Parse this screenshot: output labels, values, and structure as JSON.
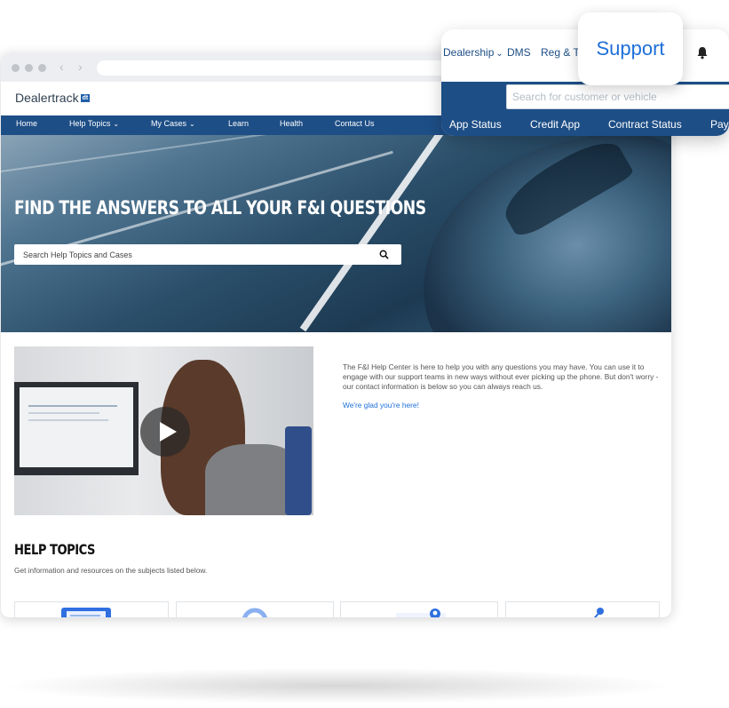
{
  "site": {
    "logo_text": "Dealertrack",
    "logo_badge": "dt"
  },
  "nav": {
    "items": [
      {
        "label": "Home",
        "dropdown": false
      },
      {
        "label": "Help Topics",
        "dropdown": true
      },
      {
        "label": "My Cases",
        "dropdown": true
      },
      {
        "label": "Learn",
        "dropdown": false
      },
      {
        "label": "Health",
        "dropdown": false
      },
      {
        "label": "Contact Us",
        "dropdown": false
      }
    ]
  },
  "hero": {
    "title": "FIND THE ANSWERS TO ALL YOUR F&I QUESTIONS",
    "search_placeholder": "Search Help Topics and Cases"
  },
  "intro": {
    "text": "The F&I Help Center is here to help you with any questions you may have. You can use it to engage with our support teams in new ways without ever picking up the phone. But don't worry - our contact information is below so you can always reach us.",
    "link": "We're glad you're here!"
  },
  "help_topics": {
    "title": "HELP TOPICS",
    "subtitle": "Get information and resources on the subjects listed below."
  },
  "support_panel": {
    "top_items": [
      "Dealership",
      "DMS",
      "Reg & T"
    ],
    "bubble_label": "Support",
    "search_placeholder": "Search for customer or vehicle",
    "nav_items": [
      "App Status",
      "Credit App",
      "Contract Status",
      "Pay"
    ]
  },
  "colors": {
    "brand_blue": "#1d4e86",
    "link_blue": "#1e6fd9"
  },
  "icons": [
    "chevron-down-icon",
    "search-icon",
    "play-icon",
    "bell-icon"
  ]
}
